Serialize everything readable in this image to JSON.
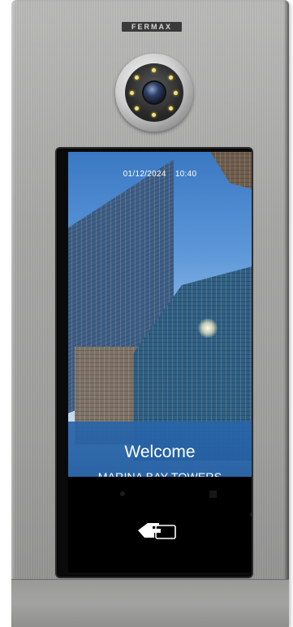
{
  "device": {
    "brand": "FERMAX"
  },
  "screen": {
    "date": "01/12/2024",
    "time": "10:40",
    "welcome": "Welcome",
    "building_name": "MARINA BAY TOWERS"
  },
  "icons": {
    "reader": "card-reader-icon"
  },
  "colors": {
    "panel": "#a5a5a4",
    "welcome_band": "#2865aa",
    "reader_area": "#000000"
  }
}
